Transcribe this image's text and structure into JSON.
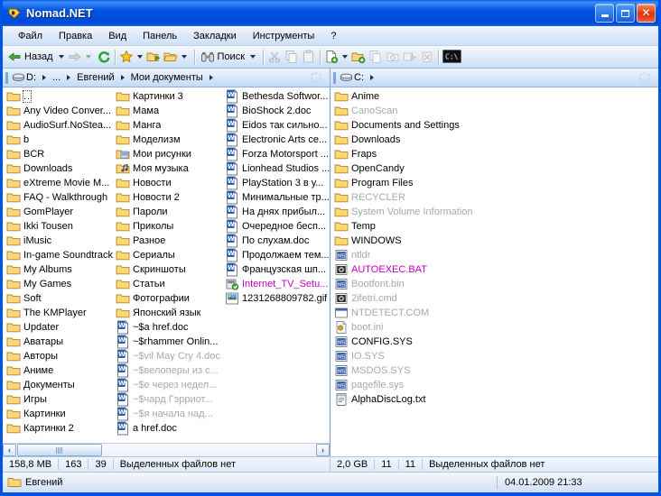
{
  "window": {
    "title": "Nomad.NET",
    "app_icon": "nomad-logo-icon",
    "minimize_label": "Minimize",
    "maximize_label": "Maximize",
    "close_label": "Close"
  },
  "menu": {
    "items": [
      {
        "label": "Файл"
      },
      {
        "label": "Правка"
      },
      {
        "label": "Вид"
      },
      {
        "label": "Панель"
      },
      {
        "label": "Закладки"
      },
      {
        "label": "Инструменты"
      },
      {
        "label": "?"
      }
    ]
  },
  "toolbar": {
    "back_label": "Назад",
    "search_label": "Поиск",
    "cmd_label": "C:\\",
    "items": [
      {
        "name": "back-button",
        "icon": "back-arrow-icon",
        "label": "Назад",
        "enabled": true
      },
      {
        "name": "back-dropdown",
        "icon": "chevron-down-icon",
        "enabled": true
      },
      {
        "name": "forward-button",
        "icon": "forward-arrow-icon",
        "enabled": false
      },
      {
        "name": "forward-dropdown",
        "icon": "chevron-down-icon",
        "enabled": false
      },
      {
        "name": "refresh-button",
        "icon": "refresh-icon",
        "enabled": true
      },
      {
        "name": "favorites-button",
        "icon": "star-icon",
        "enabled": true
      },
      {
        "name": "favorites-dropdown",
        "icon": "chevron-down-icon",
        "enabled": true
      },
      {
        "name": "open-folder-button",
        "icon": "folder-go-icon",
        "enabled": true
      },
      {
        "name": "folder-up-button",
        "icon": "folder-open-icon",
        "enabled": true
      },
      {
        "name": "folder-dropdown",
        "icon": "chevron-down-icon",
        "enabled": true
      },
      {
        "name": "search-button",
        "icon": "binoculars-icon",
        "label": "Поиск",
        "enabled": true
      },
      {
        "name": "search-dropdown",
        "icon": "chevron-down-icon",
        "enabled": true
      },
      {
        "name": "cut-button",
        "icon": "scissors-icon",
        "enabled": false
      },
      {
        "name": "copy-button",
        "icon": "copy-icon",
        "enabled": false
      },
      {
        "name": "paste-button",
        "icon": "paste-icon",
        "enabled": false
      },
      {
        "name": "new-file-button",
        "icon": "new-file-icon",
        "enabled": true
      },
      {
        "name": "new-file-dropdown",
        "icon": "chevron-down-icon",
        "enabled": true
      },
      {
        "name": "new-folder-button",
        "icon": "new-folder-icon",
        "enabled": true
      },
      {
        "name": "duplicate-button",
        "icon": "duplicate-icon",
        "enabled": false
      },
      {
        "name": "lock-button",
        "icon": "lock-icon",
        "enabled": false
      },
      {
        "name": "move-button",
        "icon": "move-right-icon",
        "enabled": false
      },
      {
        "name": "delete-button",
        "icon": "delete-icon",
        "enabled": false
      },
      {
        "name": "console-button",
        "icon": "console-icon",
        "label": "C:\\",
        "enabled": true
      }
    ]
  },
  "left_panel": {
    "breadcrumb": {
      "drive_icon": "drive-icon",
      "segments": [
        "D:",
        "...",
        "Евгений",
        "Мои документы"
      ]
    },
    "items": [
      {
        "name": "..",
        "type": "parent",
        "style": "normal",
        "focused": true
      },
      {
        "name": "Any Video Conver...",
        "type": "folder",
        "style": "normal"
      },
      {
        "name": "AudioSurf.NoStea...",
        "type": "folder",
        "style": "normal"
      },
      {
        "name": "b",
        "type": "folder",
        "style": "normal"
      },
      {
        "name": "BCR",
        "type": "folder",
        "style": "normal"
      },
      {
        "name": "Downloads",
        "type": "folder",
        "style": "normal"
      },
      {
        "name": "eXtreme Movie M...",
        "type": "folder",
        "style": "normal"
      },
      {
        "name": "FAQ - Walkthrough",
        "type": "folder",
        "style": "normal"
      },
      {
        "name": "GomPlayer",
        "type": "folder",
        "style": "normal"
      },
      {
        "name": "Ikki Tousen",
        "type": "folder",
        "style": "normal"
      },
      {
        "name": "iMusic",
        "type": "folder",
        "style": "normal"
      },
      {
        "name": "In-game Soundtrack",
        "type": "folder",
        "style": "normal"
      },
      {
        "name": "My Albums",
        "type": "folder",
        "style": "normal"
      },
      {
        "name": "My Games",
        "type": "folder",
        "style": "normal"
      },
      {
        "name": "Soft",
        "type": "folder",
        "style": "normal"
      },
      {
        "name": "The KMPlayer",
        "type": "folder",
        "style": "normal"
      },
      {
        "name": "Updater",
        "type": "folder",
        "style": "normal"
      },
      {
        "name": "Аватары",
        "type": "folder",
        "style": "normal"
      },
      {
        "name": "Авторы",
        "type": "folder",
        "style": "normal"
      },
      {
        "name": "Аниме",
        "type": "folder",
        "style": "normal"
      },
      {
        "name": "Документы",
        "type": "folder",
        "style": "normal"
      },
      {
        "name": "Игры",
        "type": "folder",
        "style": "normal"
      },
      {
        "name": "Картинки",
        "type": "folder",
        "style": "normal"
      },
      {
        "name": "Картинки 2",
        "type": "folder",
        "style": "normal"
      },
      {
        "name": "Картинки 3",
        "type": "folder",
        "style": "normal"
      },
      {
        "name": "Мама",
        "type": "folder",
        "style": "normal"
      },
      {
        "name": "Манга",
        "type": "folder",
        "style": "normal"
      },
      {
        "name": "Моделизм",
        "type": "folder",
        "style": "normal"
      },
      {
        "name": "Мои рисунки",
        "type": "folder-pictures",
        "style": "normal"
      },
      {
        "name": "Моя музыка",
        "type": "folder-music",
        "style": "normal"
      },
      {
        "name": "Новости",
        "type": "folder",
        "style": "normal"
      },
      {
        "name": "Новости 2",
        "type": "folder",
        "style": "normal"
      },
      {
        "name": "Пароли",
        "type": "folder",
        "style": "normal"
      },
      {
        "name": "Приколы",
        "type": "folder",
        "style": "normal"
      },
      {
        "name": "Разное",
        "type": "folder",
        "style": "normal"
      },
      {
        "name": "Сериалы",
        "type": "folder",
        "style": "normal"
      },
      {
        "name": "Скриншоты",
        "type": "folder",
        "style": "normal"
      },
      {
        "name": "Статьи",
        "type": "folder",
        "style": "normal"
      },
      {
        "name": "Фотографии",
        "type": "folder",
        "style": "normal"
      },
      {
        "name": "Японский язык",
        "type": "folder",
        "style": "normal"
      },
      {
        "name": "~$a href.doc",
        "type": "doc",
        "style": "normal"
      },
      {
        "name": "~$rhammer Onlin...",
        "type": "doc",
        "style": "normal"
      },
      {
        "name": "~$vil May Cry 4.doc",
        "type": "doc",
        "style": "dim"
      },
      {
        "name": "~$велоперы из с...",
        "type": "doc",
        "style": "dim"
      },
      {
        "name": "~$е через недел...",
        "type": "doc",
        "style": "dim"
      },
      {
        "name": "~$чард Гэрриот...",
        "type": "doc",
        "style": "dim"
      },
      {
        "name": "~$я начала над...",
        "type": "doc",
        "style": "dim"
      },
      {
        "name": "a href.doc",
        "type": "doc",
        "style": "normal"
      },
      {
        "name": "Bethesda Softwor...",
        "type": "doc",
        "style": "normal"
      },
      {
        "name": "BioShock 2.doc",
        "type": "doc",
        "style": "normal"
      },
      {
        "name": "Eidos так сильно...",
        "type": "doc",
        "style": "normal"
      },
      {
        "name": "Electronic Arts ce...",
        "type": "doc",
        "style": "normal"
      },
      {
        "name": "Forza Motorsport ...",
        "type": "doc",
        "style": "normal"
      },
      {
        "name": "Lionhead Studios ...",
        "type": "doc",
        "style": "normal"
      },
      {
        "name": "PlayStation 3 в у...",
        "type": "doc",
        "style": "normal"
      },
      {
        "name": "Минимальные тр...",
        "type": "doc",
        "style": "normal"
      },
      {
        "name": "На днях прибыл...",
        "type": "doc",
        "style": "normal"
      },
      {
        "name": "Очередное бесп...",
        "type": "doc",
        "style": "normal"
      },
      {
        "name": "По слухам.doc",
        "type": "doc",
        "style": "normal"
      },
      {
        "name": "Продолжаем тем...",
        "type": "doc",
        "style": "normal"
      },
      {
        "name": "Французская шп...",
        "type": "doc",
        "style": "normal"
      },
      {
        "name": "Internet_TV_Setu...",
        "type": "installer",
        "style": "magenta"
      },
      {
        "name": "1231268809782.gif",
        "type": "image",
        "style": "normal"
      }
    ],
    "status": {
      "size": "158,8 MB",
      "total_count": "163",
      "dir_count": "39",
      "selection": "Выделенных файлов нет"
    },
    "scrollbar": {
      "left_label": "◄",
      "right_label": "►"
    }
  },
  "right_panel": {
    "breadcrumb": {
      "drive_icon": "drive-icon",
      "segments": [
        "C:"
      ]
    },
    "items": [
      {
        "name": "Anime",
        "type": "folder",
        "style": "normal"
      },
      {
        "name": "CanoScan",
        "type": "folder",
        "style": "dim"
      },
      {
        "name": "Documents and Settings",
        "type": "folder",
        "style": "normal"
      },
      {
        "name": "Downloads",
        "type": "folder",
        "style": "normal"
      },
      {
        "name": "Fraps",
        "type": "folder",
        "style": "normal"
      },
      {
        "name": "OpenCandy",
        "type": "folder",
        "style": "normal"
      },
      {
        "name": "Program Files",
        "type": "folder",
        "style": "normal"
      },
      {
        "name": "RECYCLER",
        "type": "folder",
        "style": "dim"
      },
      {
        "name": "System Volume Information",
        "type": "folder",
        "style": "dim"
      },
      {
        "name": "Temp",
        "type": "folder",
        "style": "normal"
      },
      {
        "name": "WINDOWS",
        "type": "folder",
        "style": "normal"
      },
      {
        "name": "ntldr",
        "type": "sysfile",
        "style": "dim"
      },
      {
        "name": "AUTOEXEC.BAT",
        "type": "batfile",
        "style": "magenta"
      },
      {
        "name": "Bootfont.bin",
        "type": "sysfile",
        "style": "dim"
      },
      {
        "name": "2ifetri.cmd",
        "type": "batfile",
        "style": "dim"
      },
      {
        "name": "NTDETECT.COM",
        "type": "comfile",
        "style": "dim"
      },
      {
        "name": "boot.ini",
        "type": "inifile",
        "style": "dim"
      },
      {
        "name": "CONFIG.SYS",
        "type": "sysfile",
        "style": "normal"
      },
      {
        "name": "IO.SYS",
        "type": "sysfile",
        "style": "dim"
      },
      {
        "name": "MSDOS.SYS",
        "type": "sysfile",
        "style": "dim"
      },
      {
        "name": "pagefile.sys",
        "type": "sysfile",
        "style": "dim"
      },
      {
        "name": "AlphaDiscLog.txt",
        "type": "txt",
        "style": "normal"
      }
    ],
    "status": {
      "size": "2,0 GB",
      "total_count": "11",
      "dir_count": "11",
      "selection": "Выделенных файлов нет"
    }
  },
  "bottom_bar": {
    "folder_icon": "folder-icon",
    "label": "Евгений",
    "date": "04.01.2009 21:33"
  },
  "colors": {
    "title_blue": "#0054e3",
    "magenta": "#c000c0",
    "dim_gray": "#a8a8a8",
    "folder_yellow": "#fcd77a"
  }
}
